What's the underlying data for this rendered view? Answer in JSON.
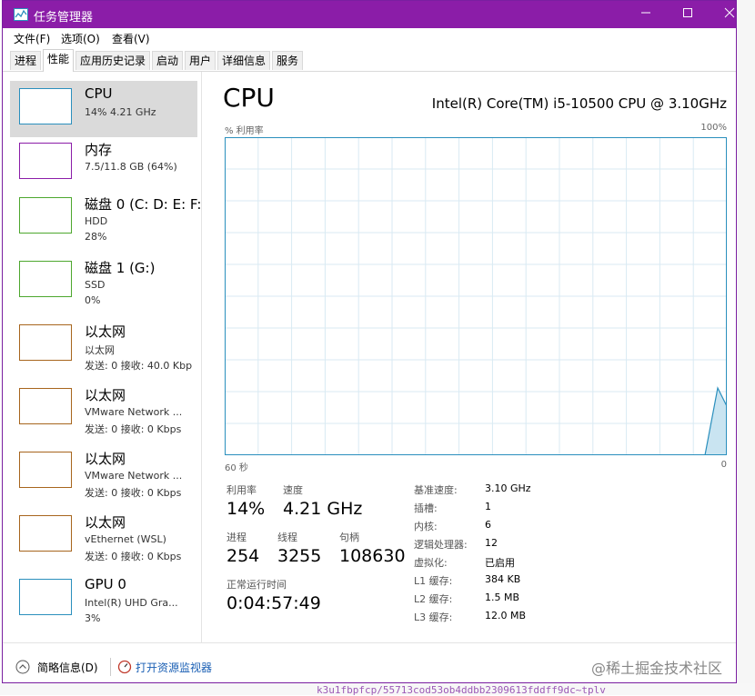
{
  "window": {
    "title": "任务管理器"
  },
  "menu": [
    "文件(F)",
    "选项(O)",
    "查看(V)"
  ],
  "tabs": [
    "进程",
    "性能",
    "应用历史记录",
    "启动",
    "用户",
    "详细信息",
    "服务"
  ],
  "sidebar": [
    {
      "name": "CPU",
      "sub": "14% 4.21 GHz",
      "sub2": "",
      "color": "#2a8fbd"
    },
    {
      "name": "内存",
      "sub": "7.5/11.8 GB (64%)",
      "sub2": "",
      "color": "#8b1da8"
    },
    {
      "name": "磁盘 0 (C: D: E: F:",
      "sub": "HDD",
      "sub2": "28%",
      "color": "#4da72e"
    },
    {
      "name": "磁盘 1 (G:)",
      "sub": "SSD",
      "sub2": "0%",
      "color": "#4da72e"
    },
    {
      "name": "以太网",
      "sub": "以太网",
      "sub2": "发送: 0 接收: 40.0 Kbp",
      "color": "#a7651d"
    },
    {
      "name": "以太网",
      "sub": "VMware Network ...",
      "sub2": "发送: 0 接收: 0 Kbps",
      "color": "#a7651d"
    },
    {
      "name": "以太网",
      "sub": "VMware Network ...",
      "sub2": "发送: 0 接收: 0 Kbps",
      "color": "#a7651d"
    },
    {
      "name": "以太网",
      "sub": "vEthernet (WSL)",
      "sub2": "发送: 0 接收: 0 Kbps",
      "color": "#a7651d"
    },
    {
      "name": "GPU 0",
      "sub": "Intel(R) UHD Gra...",
      "sub2": "3%",
      "color": "#2a8fbd"
    }
  ],
  "cpu": {
    "title": "CPU",
    "model": "Intel(R) Core(TM) i5-10500 CPU @ 3.10GHz",
    "axis_top_left": "% 利用率",
    "axis_top_right": "100%",
    "axis_bottom_left": "60 秒",
    "axis_bottom_right": "0",
    "utilization_label": "利用率",
    "utilization": "14%",
    "speed_label": "速度",
    "speed": "4.21 GHz",
    "processes_label": "进程",
    "processes": "254",
    "threads_label": "线程",
    "threads": "3255",
    "handles_label": "句柄",
    "handles": "108630",
    "uptime_label": "正常运行时间",
    "uptime": "0:04:57:49"
  },
  "cpu_info": [
    {
      "label": "基准速度:",
      "value": "3.10 GHz"
    },
    {
      "label": "插槽:",
      "value": "1"
    },
    {
      "label": "内核:",
      "value": "6"
    },
    {
      "label": "逻辑处理器:",
      "value": "12"
    },
    {
      "label": "虚拟化:",
      "value": "已启用"
    },
    {
      "label": "L1 缓存:",
      "value": "384 KB"
    },
    {
      "label": "L2 缓存:",
      "value": "1.5 MB"
    },
    {
      "label": "L3 缓存:",
      "value": "12.0 MB"
    }
  ],
  "footer": {
    "less": "简略信息(D)",
    "resource_monitor": "打开资源监视器"
  },
  "watermark": "@稀土掘金技术社区",
  "background_text": "k3u1fbpfcp/55713cod53ob4ddbb2309613fddff9dc~tplv",
  "accent": "#8b1da8",
  "graph_color": "#2a8fbd"
}
